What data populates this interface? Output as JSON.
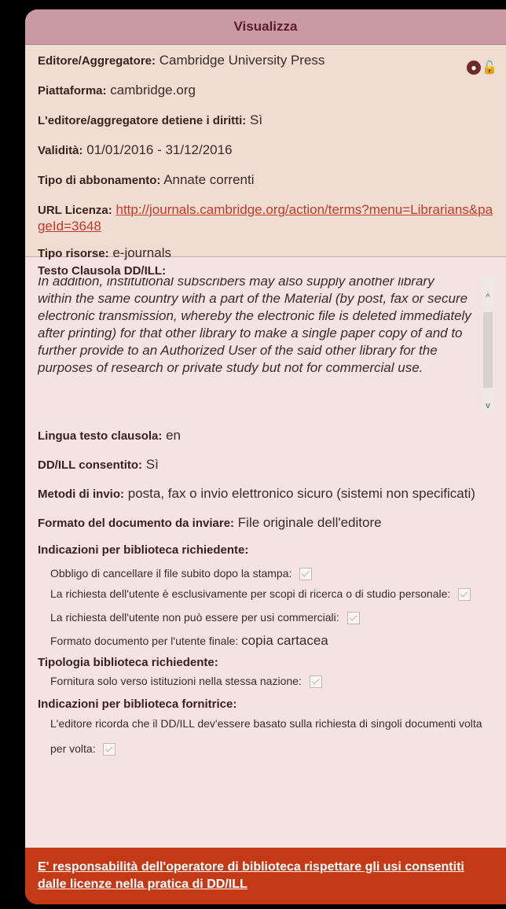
{
  "header": {
    "title": "Visualizza"
  },
  "top": {
    "editor_label": "Editore/Aggregatore:",
    "editor_value": "Cambridge University Press",
    "platform_label": "Piattaforma:",
    "platform_value": "cambridge.org",
    "rights_label": "L'editore/aggregatore detiene i diritti:",
    "rights_value": "Sì",
    "validity_label": "Validità:",
    "validity_value": "01/01/2016 - 31/12/2016",
    "subscription_label": "Tipo di abbonamento:",
    "subscription_value": "Annate correnti",
    "license_url_label": "URL Licenza:",
    "license_url_value": "http://journals.cambridge.org/action/terms?menu=Librarians&pageId=3648",
    "resource_type_label": "Tipo risorse:",
    "resource_type_value": "e-journals",
    "icons": [
      "globe-icon",
      "unlock-icon"
    ]
  },
  "clause": {
    "title": "Testo Clausola DD/ILL:",
    "text": "In addition, institutional subscribers may also supply another library within the same country with a part of the Material (by post, fax or secure electronic transmission, whereby the electronic file is deleted immediately after printing) for that other library to make a single paper copy of and to further provide to an Authorized User of the said other library for the purposes of research or private study but not for commercial use."
  },
  "fields": {
    "lingua_label": "Lingua testo clausola:",
    "lingua_value": "en",
    "ddill_label": "DD/ILL consentito:",
    "ddill_value": "Sì",
    "metodi_label": "Metodi di invio:",
    "metodi_value": "posta, fax o invio elettronico sicuro (sistemi non specificati)",
    "formato_label": "Formato del documento da inviare:",
    "formato_value": "File originale dell'editore"
  },
  "richiedente": {
    "title": "Indicazioni per biblioteca richiedente:",
    "item1": "Obbligo di cancellare il file subito dopo la stampa:",
    "item2": "La richiesta dell'utente è esclusivamente per scopi di ricerca o di studio personale:",
    "item3": "La richiesta dell'utente non può essere per usi commerciali:",
    "item4_label": "Formato documento per l'utente finale:",
    "item4_value": "copia cartacea"
  },
  "tipologia": {
    "title": "Tipologia biblioteca richiedente:",
    "item1": "Fornitura solo verso istituzioni nella stessa nazione:"
  },
  "fornitrice": {
    "title": "Indicazioni per biblioteca fornitrice:",
    "item1": "L'editore ricorda che il DD/ILL dev'essere basato sulla richiesta di singoli documenti volta per volta:"
  },
  "footer": {
    "link": "E' responsabilità dell'operatore di biblioteca rispettare gli usi consentiti dalle licenze nella pratica di DD/ILL"
  }
}
